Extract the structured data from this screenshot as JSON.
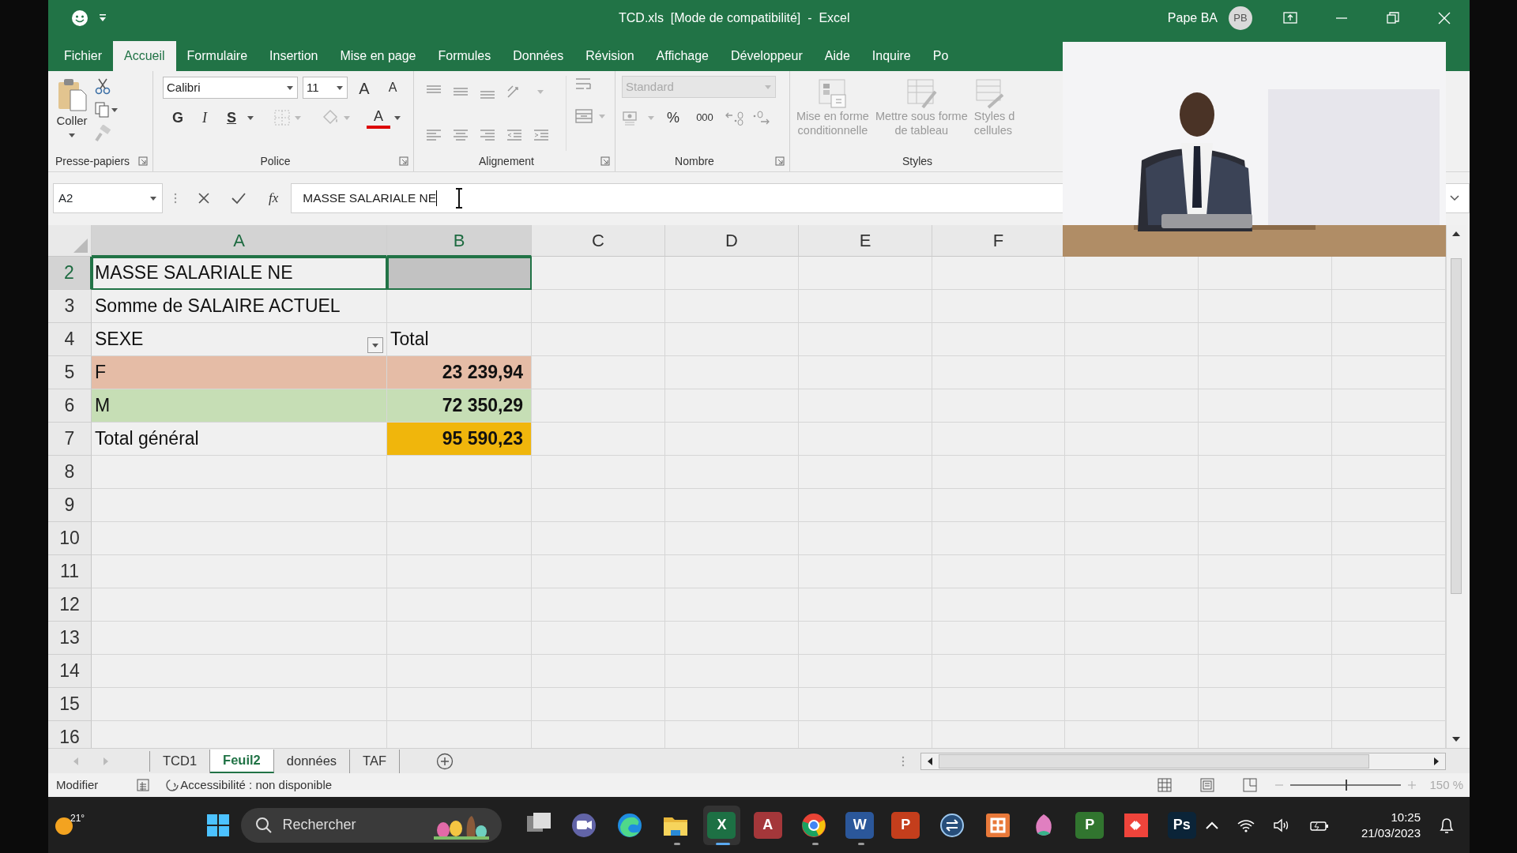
{
  "title_bar": {
    "title": "TCD.xls  [Mode de compatibilité]  -  Excel",
    "user": "Pape BA",
    "initials": "PB"
  },
  "ribbon_tabs": [
    {
      "label": "Fichier",
      "selected": false
    },
    {
      "label": "Accueil",
      "selected": true
    },
    {
      "label": "Formulaire",
      "selected": false
    },
    {
      "label": "Insertion",
      "selected": false
    },
    {
      "label": "Mise en page",
      "selected": false
    },
    {
      "label": "Formules",
      "selected": false
    },
    {
      "label": "Données",
      "selected": false
    },
    {
      "label": "Révision",
      "selected": false
    },
    {
      "label": "Affichage",
      "selected": false
    },
    {
      "label": "Développeur",
      "selected": false
    },
    {
      "label": "Aide",
      "selected": false
    },
    {
      "label": "Inquire",
      "selected": false
    },
    {
      "label": "Po",
      "selected": false
    }
  ],
  "ribbon": {
    "clipboard": {
      "label": "Presse-papiers",
      "paste": "Coller"
    },
    "font": {
      "label": "Police",
      "font": "Calibri",
      "size": "11",
      "grow": "A",
      "shrink": "A",
      "bold": "G",
      "italic": "I",
      "underline": "S",
      "font_color": "A"
    },
    "alignment": {
      "label": "Alignement"
    },
    "number": {
      "label": "Nombre",
      "format": "Standard",
      "format_disabled": true,
      "percent": "%",
      "thousands": "000"
    },
    "styles": {
      "label": "Styles",
      "buttons": [
        {
          "lines": [
            "Mise en forme",
            "conditionnelle"
          ],
          "disabled": true
        },
        {
          "lines": [
            "Mettre sous forme",
            "de tableau"
          ],
          "disabled": true
        },
        {
          "lines": [
            "Styles d",
            "cellules"
          ],
          "disabled": true
        }
      ]
    }
  },
  "formula_bar": {
    "name_box": "A2",
    "function_label": "fx",
    "value": "MASSE SALARIALE NE"
  },
  "sheet": {
    "columns": [
      {
        "label": "A",
        "selected": true
      },
      {
        "label": "B",
        "selected": true
      },
      {
        "label": "C",
        "selected": false
      },
      {
        "label": "D",
        "selected": false
      },
      {
        "label": "E",
        "selected": false
      },
      {
        "label": "F",
        "selected": false
      }
    ],
    "rows": [
      {
        "number": "2",
        "selected": true,
        "cells": [
          {
            "text": "MASSE SALARIALE NE",
            "selected": true
          },
          {
            "color": "#c2c2c2",
            "selected": true
          }
        ]
      },
      {
        "number": "3",
        "selected": false,
        "cells": [
          {
            "text": "Somme de SALAIRE ACTUEL",
            "selected": false
          }
        ]
      },
      {
        "number": "4",
        "selected": false,
        "cells": [
          {
            "text": "SEXE",
            "filter": true,
            "selected": false
          },
          {
            "text": "Total",
            "selected": false
          }
        ]
      },
      {
        "number": "5",
        "selected": false,
        "cells": [
          {
            "text": "F",
            "color": "#e5bca6",
            "selected": false
          },
          {
            "text": "23 239,94",
            "color": "#e5bca6",
            "bold": true,
            "selected": false
          }
        ]
      },
      {
        "number": "6",
        "selected": false,
        "cells": [
          {
            "text": "M",
            "color": "#c6deb5",
            "selected": false
          },
          {
            "text": "72 350,29",
            "color": "#c6deb5",
            "bold": true,
            "selected": false
          }
        ]
      },
      {
        "number": "7",
        "selected": false,
        "cells": [
          {
            "text": "Total général",
            "selected": false
          },
          {
            "text": "95 590,23",
            "color": "#f0b60c",
            "bold": true,
            "selected": false
          }
        ]
      },
      {
        "number": "8",
        "selected": false
      },
      {
        "number": "9",
        "selected": false
      },
      {
        "number": "10",
        "selected": false
      },
      {
        "number": "11",
        "selected": false
      },
      {
        "number": "12",
        "selected": false
      },
      {
        "number": "13",
        "selected": false
      },
      {
        "number": "14",
        "selected": false
      },
      {
        "number": "15",
        "selected": false
      },
      {
        "number": "16",
        "selected": false
      }
    ]
  },
  "sheet_tabs": [
    {
      "label": "TCD1",
      "selected": false
    },
    {
      "label": "Feuil2",
      "selected": true
    },
    {
      "label": "données",
      "selected": false
    },
    {
      "label": "TAF",
      "selected": false
    }
  ],
  "status_bar": {
    "mode": "Modifier",
    "accessibility": "Accessibilité : non disponible",
    "zoom": "150 %",
    "zoom_slider": {
      "level": 0.5
    }
  },
  "taskbar": {
    "weather": "21°",
    "search_placeholder": "Rechercher",
    "apps": [
      {
        "kind": "stack",
        "running": false,
        "selected": false
      },
      {
        "kind": "camera",
        "running": false,
        "selected": false
      },
      {
        "kind": "wave",
        "running": false,
        "selected": false
      },
      {
        "kind": "folder",
        "running": true,
        "selected": false
      },
      {
        "kind": "tile",
        "label": "X",
        "color": "#1d7044",
        "running": true,
        "selected": true
      },
      {
        "kind": "tile",
        "label": "A",
        "color": "#a4373a",
        "running": false,
        "selected": false
      },
      {
        "kind": "ball",
        "running": true,
        "selected": false
      },
      {
        "kind": "tile",
        "label": "W",
        "color": "#2b579a",
        "running": true,
        "selected": false
      },
      {
        "kind": "tile",
        "label": "P",
        "color": "#c43e1c",
        "running": false,
        "selected": false
      },
      {
        "kind": "ring",
        "running": false,
        "selected": false
      },
      {
        "kind": "knot",
        "running": false,
        "selected": false
      },
      {
        "kind": "leaf",
        "running": false,
        "selected": false
      },
      {
        "kind": "tile",
        "label": "P",
        "color": "#31752f",
        "running": false,
        "selected": false
      },
      {
        "kind": "diamond",
        "running": false,
        "selected": false
      },
      {
        "kind": "tile",
        "label": "Ps",
        "color": "#0b2438",
        "running": false,
        "selected": false
      }
    ],
    "time": "10:25",
    "date": "21/03/2023"
  }
}
